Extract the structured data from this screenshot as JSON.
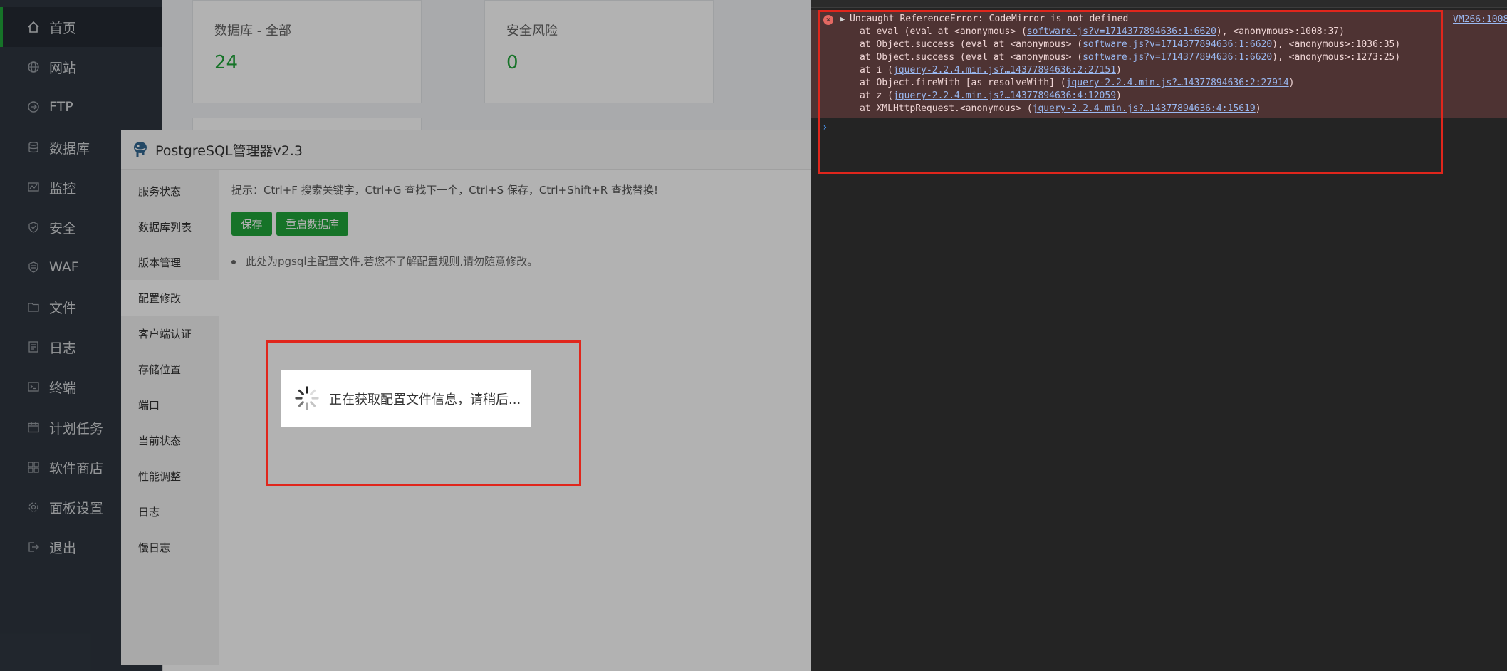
{
  "sidebar": {
    "items": [
      {
        "label": "首页",
        "icon": "home-icon",
        "active": true
      },
      {
        "label": "网站",
        "icon": "globe-icon"
      },
      {
        "label": "FTP",
        "icon": "ftp-icon"
      },
      {
        "label": "数据库",
        "icon": "database-icon"
      },
      {
        "label": "监控",
        "icon": "monitor-icon"
      },
      {
        "label": "安全",
        "icon": "shield-icon"
      },
      {
        "label": "WAF",
        "icon": "waf-shield-icon"
      },
      {
        "label": "文件",
        "icon": "folder-icon"
      },
      {
        "label": "日志",
        "icon": "log-icon"
      },
      {
        "label": "终端",
        "icon": "terminal-icon"
      },
      {
        "label": "计划任务",
        "icon": "calendar-icon"
      },
      {
        "label": "软件商店",
        "icon": "apps-icon"
      },
      {
        "label": "面板设置",
        "icon": "gear-icon"
      },
      {
        "label": "退出",
        "icon": "logout-icon"
      }
    ]
  },
  "overview": {
    "cards": [
      {
        "title": "数据库 - 全部",
        "value": "24"
      },
      {
        "title": "安全风险",
        "value": "0"
      }
    ]
  },
  "dialog": {
    "title": "PostgreSQL管理器v2.3",
    "menu": [
      "服务状态",
      "数据库列表",
      "版本管理",
      "配置修改",
      "客户端认证",
      "存储位置",
      "端口",
      "当前状态",
      "性能调整",
      "日志",
      "慢日志"
    ],
    "active_menu": "配置修改",
    "tip": "提示：Ctrl+F 搜索关键字，Ctrl+G 查找下一个，Ctrl+S 保存，Ctrl+Shift+R 查找替换!",
    "save_label": "保存",
    "restart_label": "重启数据库",
    "note": "此处为pgsql主配置文件,若您不了解配置规则,请勿随意修改。",
    "loading_text": "正在获取配置文件信息，请稍后..."
  },
  "console": {
    "error_title": "Uncaught ReferenceError: CodeMirror is not defined",
    "vm_link": "VM266:1008",
    "stack": [
      {
        "pre": "at eval (eval at <anonymous> (",
        "link": "software.js?v=1714377894636:1:6620",
        "post": "), <anonymous>:1008:37)"
      },
      {
        "pre": "at Object.success (eval at <anonymous> (",
        "link": "software.js?v=1714377894636:1:6620",
        "post": "), <anonymous>:1036:35)"
      },
      {
        "pre": "at Object.success (eval at <anonymous> (",
        "link": "software.js?v=1714377894636:1:6620",
        "post": "), <anonymous>:1273:25)"
      },
      {
        "pre": "at i (",
        "link": "jquery-2.2.4.min.js?…14377894636:2:27151",
        "post": ")"
      },
      {
        "pre": "at Object.fireWith [as resolveWith] (",
        "link": "jquery-2.2.4.min.js?…14377894636:2:27914",
        "post": ")"
      },
      {
        "pre": "at z (",
        "link": "jquery-2.2.4.min.js?…14377894636:4:12059",
        "post": ")"
      },
      {
        "pre": "at XMLHttpRequest.<anonymous> (",
        "link": "jquery-2.2.4.min.js?…14377894636:4:15619",
        "post": ")"
      }
    ],
    "prompt": "›"
  }
}
